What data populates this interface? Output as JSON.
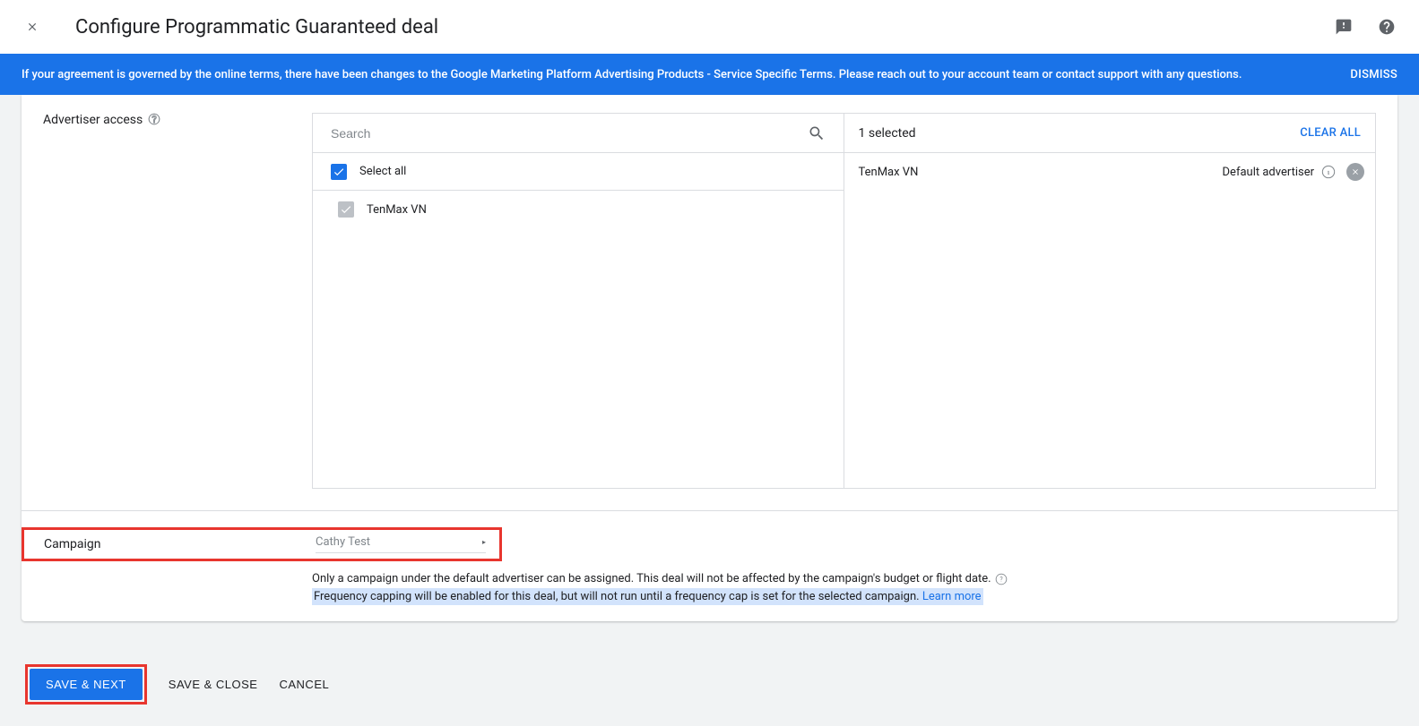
{
  "header": {
    "title": "Configure Programmatic Guaranteed deal"
  },
  "banner": {
    "text": "If your agreement is governed by the online terms, there have been changes to the Google Marketing Platform Advertising Products - Service Specific Terms. Please reach out to your account team or contact support with any questions.",
    "dismiss": "DISMISS"
  },
  "advertiser": {
    "label": "Advertiser access",
    "search_placeholder": "Search",
    "select_all": "Select all",
    "items": [
      {
        "name": "TenMax VN"
      }
    ],
    "selected_count": "1 selected",
    "clear_all": "CLEAR ALL",
    "selected": [
      {
        "name": "TenMax VN",
        "default_label": "Default advertiser"
      }
    ]
  },
  "campaign": {
    "label": "Campaign",
    "value": "Cathy Test",
    "note1": "Only a campaign under the default advertiser can be assigned. This deal will not be affected by the campaign's budget or flight date.",
    "note2": "Frequency capping will be enabled for this deal, but will not run until a frequency cap is set for the selected campaign.",
    "learn_more": "Learn more"
  },
  "footer": {
    "save_next": "SAVE & NEXT",
    "save_close": "SAVE & CLOSE",
    "cancel": "CANCEL"
  }
}
